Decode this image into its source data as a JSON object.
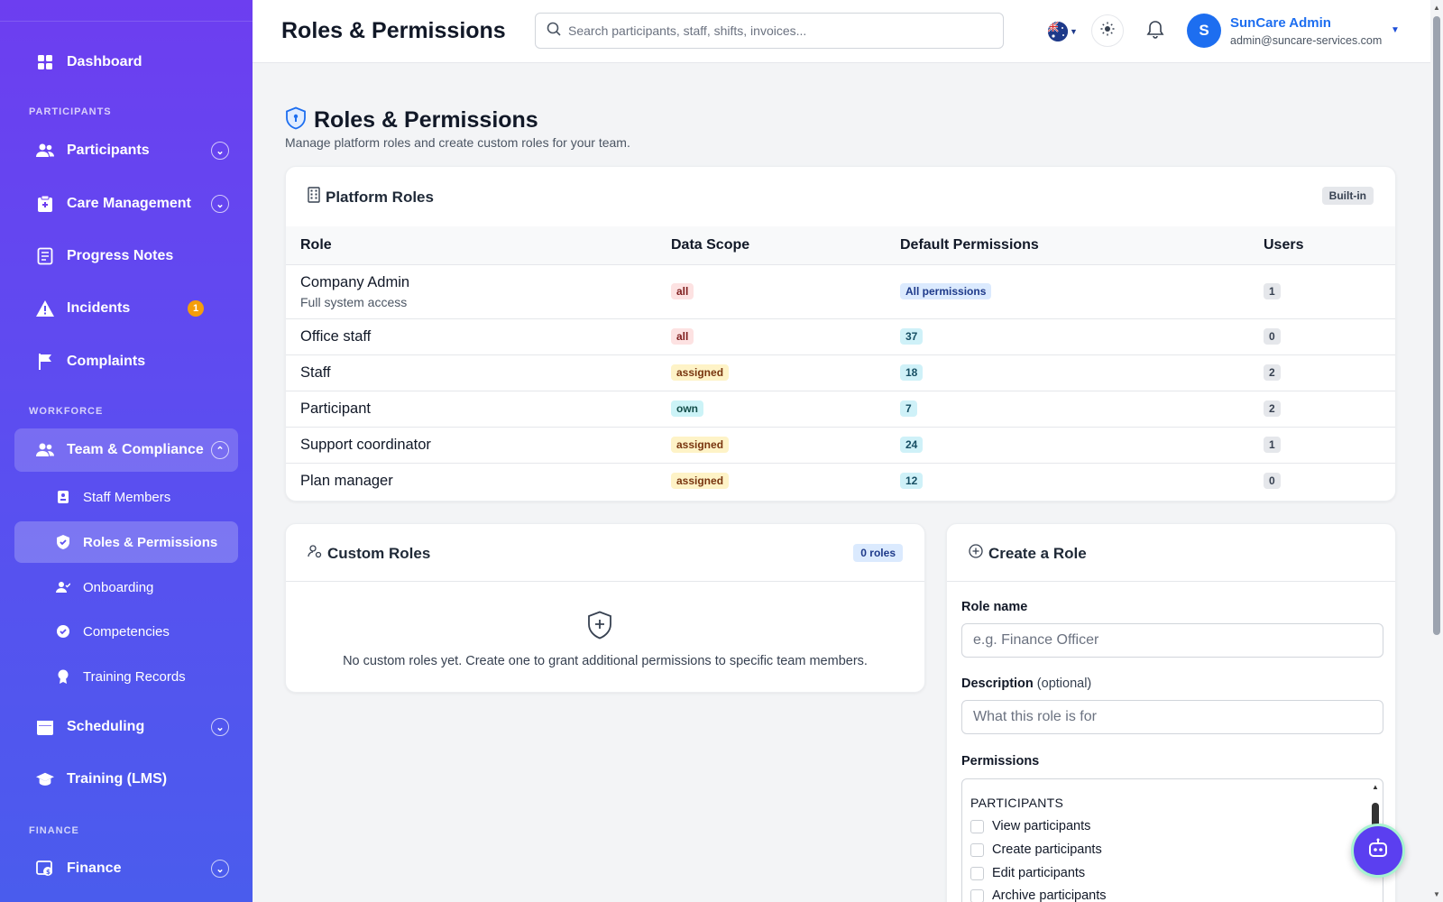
{
  "sidebar": {
    "dashboard": "Dashboard",
    "section_participants": "PARTICIPANTS",
    "participants": "Participants",
    "care_management": "Care Management",
    "progress_notes": "Progress Notes",
    "incidents": "Incidents",
    "incidents_badge": "1",
    "complaints": "Complaints",
    "section_workforce": "WORKFORCE",
    "team_compliance": "Team & Compliance",
    "staff_members": "Staff Members",
    "roles_permissions": "Roles & Permissions",
    "onboarding": "Onboarding",
    "competencies": "Competencies",
    "training_records": "Training Records",
    "scheduling": "Scheduling",
    "training_lms": "Training (LMS)",
    "section_finance": "FINANCE",
    "finance": "Finance"
  },
  "header": {
    "title": "Roles & Permissions",
    "search_placeholder": "Search participants, staff, shifts, invoices...",
    "user_initial": "S",
    "user_name": "SunCare Admin",
    "user_email": "admin@suncare-services.com"
  },
  "page": {
    "title": "Roles & Permissions",
    "subtitle": "Manage platform roles and create custom roles for your team."
  },
  "platform_roles": {
    "title": "Platform Roles",
    "badge": "Built-in",
    "columns": [
      "Role",
      "Data Scope",
      "Default Permissions",
      "Users"
    ],
    "rows": [
      {
        "name": "Company Admin",
        "desc": "Full system access",
        "scope": "all",
        "perms": "All permissions",
        "users": "1"
      },
      {
        "name": "Office staff",
        "desc": "",
        "scope": "all",
        "perms": "37",
        "users": "0"
      },
      {
        "name": "Staff",
        "desc": "",
        "scope": "assigned",
        "perms": "18",
        "users": "2"
      },
      {
        "name": "Participant",
        "desc": "",
        "scope": "own",
        "perms": "7",
        "users": "2"
      },
      {
        "name": "Support coordinator",
        "desc": "",
        "scope": "assigned",
        "perms": "24",
        "users": "1"
      },
      {
        "name": "Plan manager",
        "desc": "",
        "scope": "assigned",
        "perms": "12",
        "users": "0"
      }
    ]
  },
  "custom_roles": {
    "title": "Custom Roles",
    "badge": "0 roles",
    "empty_text": "No custom roles yet. Create one to grant additional permissions to specific team members."
  },
  "create_role": {
    "title": "Create a Role",
    "role_name_label": "Role name",
    "role_name_placeholder": "e.g. Finance Officer",
    "description_label": "Description",
    "description_optional": "(optional)",
    "description_placeholder": "What this role is for",
    "permissions_label": "Permissions",
    "group": "PARTICIPANTS",
    "permissions": [
      "View participants",
      "Create participants",
      "Edit participants",
      "Archive participants"
    ]
  },
  "colors": {
    "accent": "#1d6ef0",
    "sidebar_top": "#6d3ef0",
    "sidebar_bottom": "#4a5ced"
  }
}
